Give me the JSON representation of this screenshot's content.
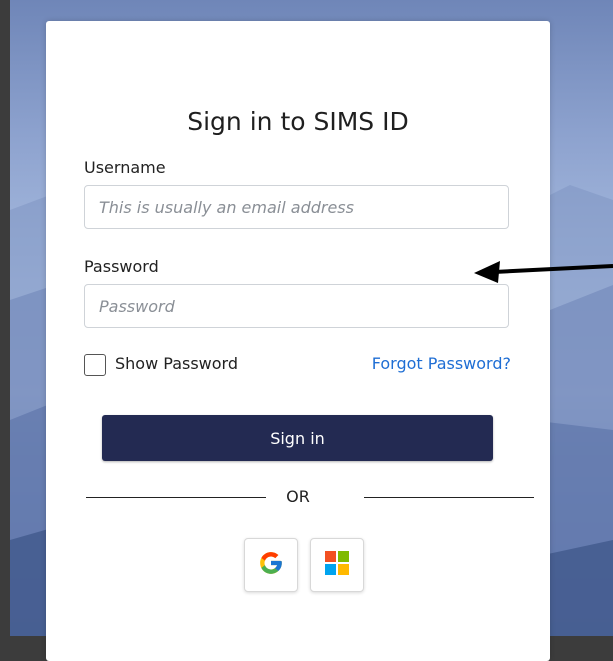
{
  "colors": {
    "primary_button": "#232a52",
    "link": "#1f6ed4",
    "card_background": "#ffffff"
  },
  "signin": {
    "title": "Sign in to SIMS ID",
    "username_label": "Username",
    "username_placeholder": "This is usually an email address",
    "username_value": "",
    "password_label": "Password",
    "password_placeholder": "Password",
    "password_value": "",
    "show_password_label": "Show Password",
    "show_password_checked": false,
    "forgot_password_label": "Forgot Password?",
    "signin_button_label": "Sign in",
    "divider_text": "OR"
  },
  "social_buttons": [
    {
      "icon": "google-icon"
    },
    {
      "icon": "microsoft-icon"
    }
  ],
  "annotation": {
    "icon": "arrow-left-icon"
  }
}
